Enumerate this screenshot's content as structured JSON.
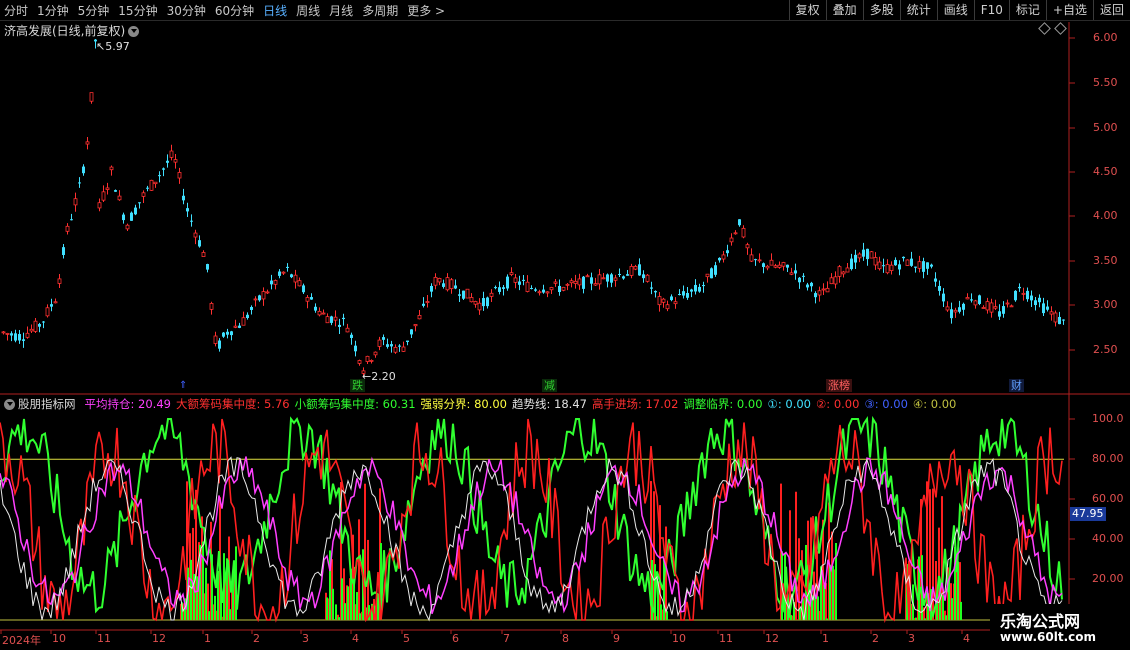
{
  "toolbar": {
    "periods": [
      "分时",
      "1分钟",
      "5分钟",
      "15分钟",
      "30分钟",
      "60分钟",
      "日线",
      "周线",
      "月线",
      "多周期",
      "更多 >"
    ],
    "active_period": "日线",
    "right_buttons": [
      "复权",
      "叠加",
      "多股",
      "统计",
      "画线",
      "F10",
      "标记",
      "+自选",
      "返回"
    ]
  },
  "kline": {
    "title": "济高发展(日线,前复权)",
    "y_ticks": [
      "6.00",
      "5.50",
      "5.00",
      "4.50",
      "4.00",
      "3.50",
      "3.00",
      "2.50"
    ],
    "high_label": "5.97",
    "low_label": "2.20"
  },
  "events": [
    {
      "label": "跌",
      "color": "#30d030",
      "bg": "#0a2a0a"
    },
    {
      "label": "减",
      "color": "#30d030",
      "bg": "#0a2a0a"
    },
    {
      "label": "涨榜",
      "color": "#ff6060",
      "bg": "#3a1010"
    },
    {
      "label": "财",
      "color": "#60a0ff",
      "bg": "#101a3a"
    }
  ],
  "indicator": {
    "name": "股朋指标网",
    "items": [
      {
        "text": "平均持仓: 20.49",
        "color": "#ff40ff"
      },
      {
        "text": "大额筹码集中度: 5.76",
        "color": "#ff3030"
      },
      {
        "text": "小额筹码集中度: 60.31",
        "color": "#30ff30"
      },
      {
        "text": "强弱分界: 80.00",
        "color": "#ffff40"
      },
      {
        "text": "趋势线: 18.47",
        "color": "#e0e0e0"
      },
      {
        "text": "高手进场: 17.02",
        "color": "#ff3030"
      },
      {
        "text": "调整临界: 0.00",
        "color": "#30ff30"
      },
      {
        "text": "①: 0.00",
        "color": "#40e0ff"
      },
      {
        "text": "②: 0.00",
        "color": "#ff3030"
      },
      {
        "text": "③: 0.00",
        "color": "#4060ff"
      },
      {
        "text": "④: 0.00",
        "color": "#c0c040"
      }
    ],
    "y_ticks": [
      "100.0",
      "80.00",
      "60.00",
      "40.00",
      "20.00"
    ],
    "current_value": "47.95"
  },
  "x_axis": [
    "2024年",
    "10",
    "11",
    "12",
    "1",
    "2",
    "3",
    "4",
    "5",
    "6",
    "7",
    "8",
    "9",
    "10",
    "11",
    "12",
    "1",
    "2",
    "3",
    "4"
  ],
  "watermark": {
    "line1": "乐淘公式网",
    "line2": "www.60lt.com"
  }
}
